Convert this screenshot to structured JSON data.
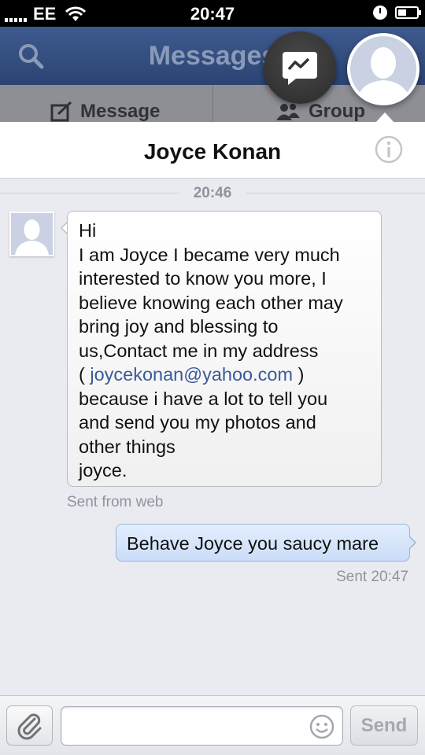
{
  "status_bar": {
    "carrier": "EE",
    "time": "20:47"
  },
  "nav": {
    "title": "Messages",
    "tabs": [
      {
        "label": "Message"
      },
      {
        "label": "Group"
      }
    ]
  },
  "conversation": {
    "contact_name": "Joyce Konan",
    "time_separator": "20:46",
    "incoming": {
      "lines": [
        "Hi",
        "I am Joyce I became very much",
        "interested to know you more, I",
        "believe knowing each other may",
        "bring joy and blessing to",
        "us,Contact me in my address"
      ],
      "link_prefix": "( ",
      "link_text": "joycekonan@yahoo.com",
      "link_suffix": " )",
      "lines_after": [
        "because i have a lot to tell you",
        "and send you my photos and",
        "other things",
        "joyce."
      ],
      "meta": "Sent from web"
    },
    "outgoing": {
      "text": "Behave Joyce you saucy mare",
      "meta": "Sent 20:47"
    }
  },
  "composer": {
    "placeholder": "",
    "send_label": "Send"
  },
  "colors": {
    "nav_blue": "#3e5a8f",
    "link": "#3b5b98",
    "outgoing_bubble": "#cadcf7"
  },
  "icons": [
    "signal-icon",
    "wifi-icon",
    "clock-icon",
    "battery-icon",
    "search-icon",
    "compose-icon",
    "group-icon",
    "messenger-icon",
    "info-icon",
    "paperclip-icon",
    "emoji-icon"
  ]
}
